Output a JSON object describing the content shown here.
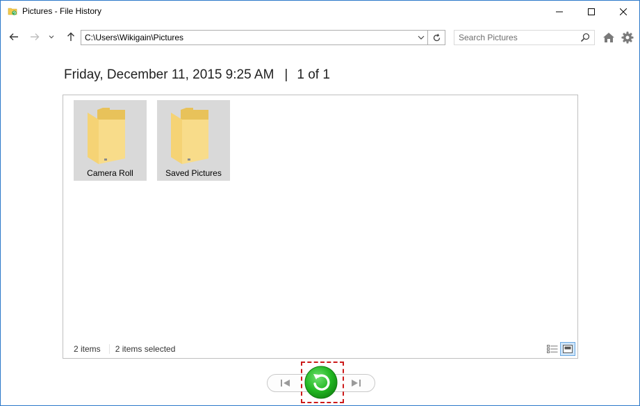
{
  "window": {
    "title": "Pictures - File History"
  },
  "toolbar": {
    "address_value": "C:\\Users\\Wikigain\\Pictures",
    "search_placeholder": "Search Pictures"
  },
  "header": {
    "date_label": "Friday, December 11, 2015 9:25 AM",
    "separator": "|",
    "page_indicator": "1 of 1"
  },
  "items": [
    {
      "label": "Camera Roll",
      "icon": "folder-icon"
    },
    {
      "label": "Saved Pictures",
      "icon": "folder-icon"
    }
  ],
  "status": {
    "item_count": "2 items",
    "selected_count": "2 items selected"
  },
  "colors": {
    "folder": "#f7d980",
    "restore_green": "#22b722",
    "highlight_red": "#cc1a1a",
    "window_border": "#2b78c9"
  }
}
